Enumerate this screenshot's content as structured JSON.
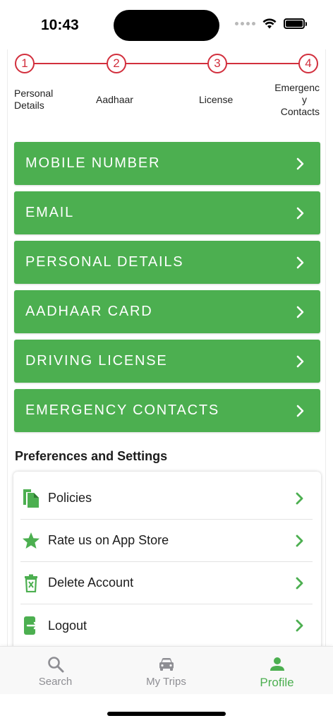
{
  "status_bar": {
    "time": "10:43"
  },
  "stepper": {
    "steps": [
      {
        "number": "1",
        "label_line1": "Personal",
        "label_line2": "Details"
      },
      {
        "number": "2",
        "label_line1": "Aadhaar",
        "label_line2": ""
      },
      {
        "number": "3",
        "label_line1": "License",
        "label_line2": ""
      },
      {
        "number": "4",
        "label_line1": "Emergenc",
        "label_line2": "y",
        "label_line3": "Contacts"
      }
    ]
  },
  "profile_sections": [
    {
      "label": "MOBILE NUMBER"
    },
    {
      "label": "EMAIL"
    },
    {
      "label": "PERSONAL DETAILS"
    },
    {
      "label": "AADHAAR CARD"
    },
    {
      "label": "DRIVING LICENSE"
    },
    {
      "label": "EMERGENCY CONTACTS"
    }
  ],
  "preferences": {
    "title": "Preferences and Settings",
    "items": [
      {
        "label": "Policies",
        "icon": "document-icon"
      },
      {
        "label": "Rate us on App Store",
        "icon": "star-icon"
      },
      {
        "label": "Delete Account",
        "icon": "trash-icon"
      },
      {
        "label": "Logout",
        "icon": "logout-icon"
      }
    ]
  },
  "tab_bar": {
    "tabs": [
      {
        "label": "Search",
        "icon": "search-icon",
        "active": false
      },
      {
        "label": "My Trips",
        "icon": "car-icon",
        "active": false
      },
      {
        "label": "Profile",
        "icon": "person-icon",
        "active": true
      }
    ]
  },
  "colors": {
    "accent_green": "#4caf50",
    "step_red": "#d22f3d",
    "tab_inactive": "#8e8e93"
  }
}
